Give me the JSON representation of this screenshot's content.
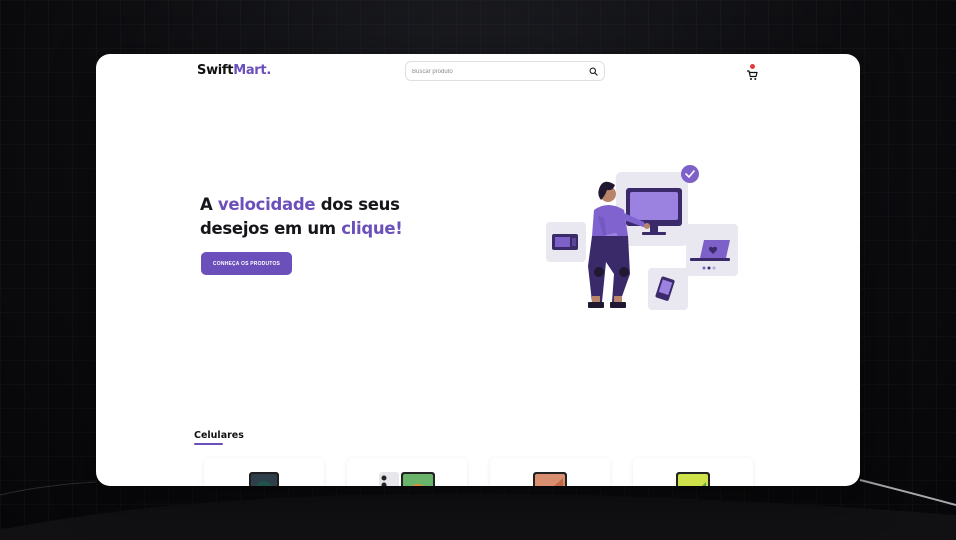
{
  "header": {
    "logo_main": "Swift",
    "logo_accent": "Mart."
  },
  "search": {
    "placeholder": "Buscar produto",
    "icon": "search-icon"
  },
  "cart": {
    "icon": "cart-icon"
  },
  "hero": {
    "title_part1": "A ",
    "title_highlight1": "velocidade",
    "title_part2": " dos seus desejos em um ",
    "title_highlight2": "clique!",
    "cta_label": "CONHEÇA OS PRODUTOS"
  },
  "products_section": {
    "title": "Celulares",
    "items": [
      {
        "image": "phone-image"
      },
      {
        "image": "phone-image"
      },
      {
        "image": "phone-image"
      },
      {
        "image": "phone-image"
      }
    ]
  },
  "colors": {
    "accent": "#6b4fbb",
    "badge": "#e23b3b",
    "text": "#15151a"
  }
}
